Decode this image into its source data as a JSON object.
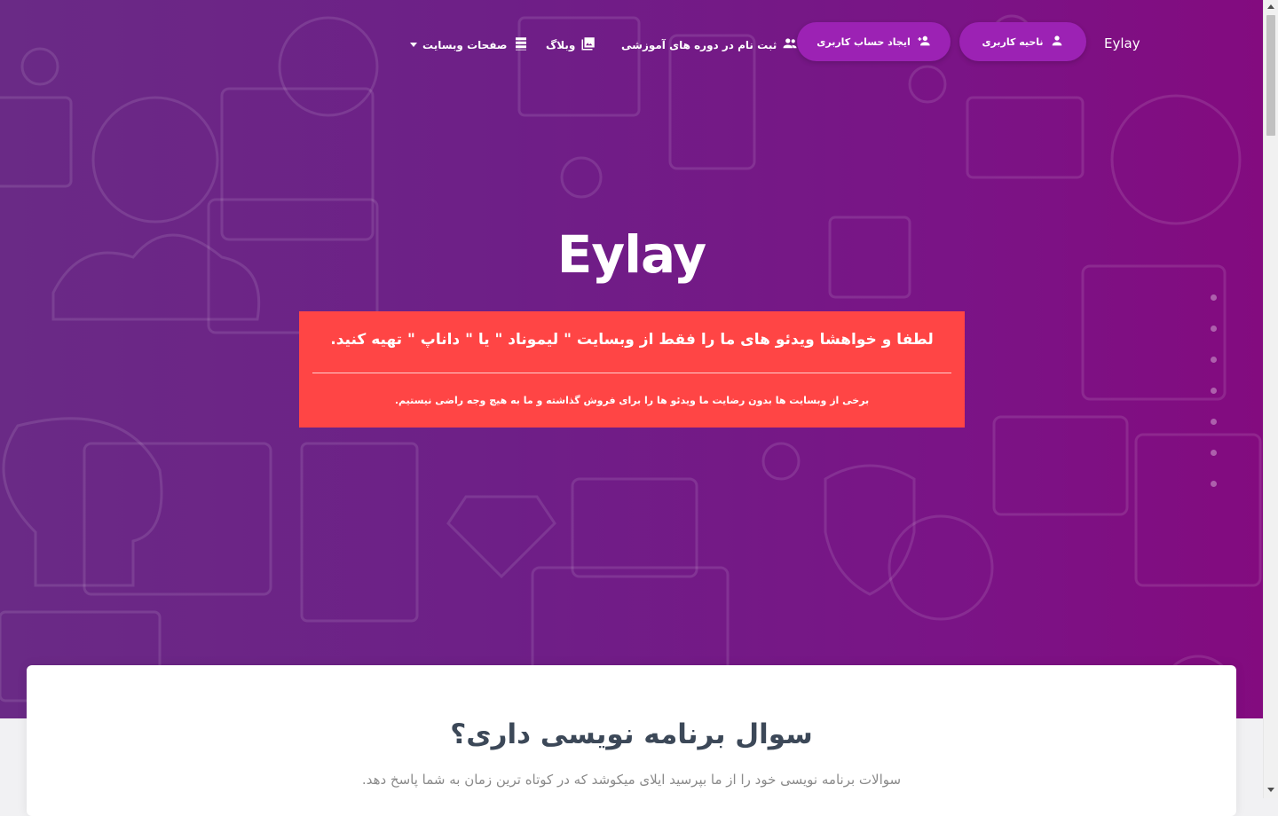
{
  "nav": {
    "brand": "Eylay",
    "account_label": "ناحیه کاربری",
    "signup_label": "ایجاد حساب کاربری",
    "courses_label": "ثبت نام در دوره های آموزشی",
    "blog_label": "وبلاگ",
    "pages_label": "صفحات وبسایت"
  },
  "hero": {
    "title": "Eylay",
    "notice_main": "لطفا و خواهشا ویدئو های ما را فقط از وبسایت \" لیموناد \" یا \" داناپ \" تهیه کنید.",
    "notice_sub": "برخی از وبسایت ها بدون رضایت ما ویدئو ها را برای فروش گذاشته و ما به هیچ وجه راضی نیستیم."
  },
  "carousel": {
    "dot_count": 7
  },
  "card": {
    "title": "سوال برنامه نویسی داری؟",
    "subtitle": "سوالات برنامه نویسی خود را از ما بپرسید ایلای میکوشد که در کوتاه ترین زمان به شما پاسخ دهد."
  },
  "colors": {
    "hero_start": "#6a2a86",
    "hero_end": "#830b7f",
    "pill": "#9c22b4",
    "notice": "#ff4545"
  },
  "icons": {
    "account": "person-icon",
    "signup": "person-add-icon",
    "courses": "group-icon",
    "blog": "photo-library-icon",
    "pages": "view-list-icon"
  }
}
